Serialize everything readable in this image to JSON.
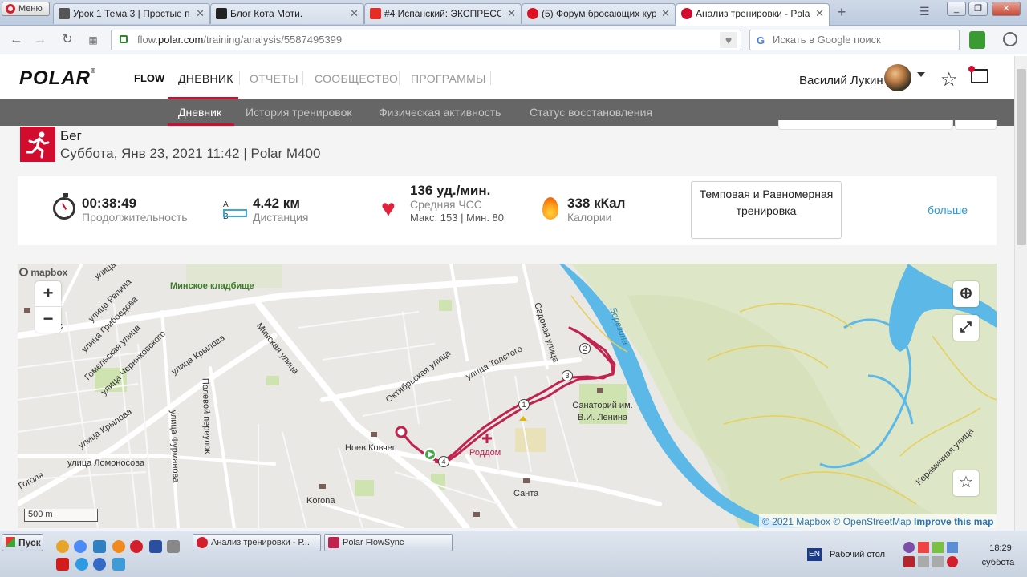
{
  "browser": {
    "menu_label": "Меню",
    "tabs": [
      {
        "title": "Урок 1 Тема 3 | Простые пр",
        "icon": "lesson-icon"
      },
      {
        "title": "Блог Кота Моти.",
        "icon": "cat-icon"
      },
      {
        "title": "#4 Испанский: ЭКСПРЕСС-",
        "icon": "youtube-icon"
      },
      {
        "title": "(5) Форум бросающих кури",
        "icon": "forum-icon"
      },
      {
        "title": "Анализ тренировки - Polar F",
        "icon": "polar-icon"
      }
    ],
    "url_prefix": "flow.",
    "url_domain": "polar.com",
    "url_path": "/training/analysis/5587495399",
    "search_placeholder": "Искать в Google поиск"
  },
  "polar": {
    "logo": "POLAR",
    "logo_mark": "®",
    "product": "FLOW",
    "nav": [
      "ДНЕВНИК",
      "ОТЧЕТЫ",
      "СООБЩЕСТВО",
      "ПРОГРАММЫ"
    ],
    "user_name": "Василий Лукин",
    "subnav": [
      "Дневник",
      "История тренировок",
      "Физическая активность",
      "Статус восстановления"
    ]
  },
  "session": {
    "sport": "Бег",
    "datetime_device": "Суббота, Янв 23, 2021 11:42 | Polar M400"
  },
  "stats": {
    "duration_value": "00:38:49",
    "duration_label": "Продолжительность",
    "distance_ab": "A B",
    "distance_value": "4.42 км",
    "distance_label": "Дистанция",
    "hr_value": "136 уд./мин.",
    "hr_label": "Средняя ЧСС",
    "hr_minmax": "Макс. 153 | Мин. 80",
    "calories_value": "338 кКал",
    "calories_label": "Калории",
    "training_type": "Темповая и Равномерная тренировка",
    "more_link": "больше"
  },
  "map": {
    "logo": "mapbox",
    "zoom_in": "+",
    "zoom_out": "−",
    "scale": "500 m",
    "attribution_mapbox": "© 2021 Mapbox",
    "attribution_osm": "© OpenStreetMap",
    "improve": "Improve this map",
    "labels": {
      "cemetery": "Минское кладбище",
      "river": "Березина",
      "sanatorium": "Санаторий им. В.И. Ленина",
      "maternity": "Роддом",
      "noev": "Ноев Ковчег",
      "korona": "Korona",
      "santa": "Санта",
      "minskaya": "Минская улица",
      "krylova1": "улица Крылова",
      "krylova2": "улица Крылова",
      "oktyabrskaya": "Октябрьская улица",
      "tolstogo": "улица Толстого",
      "sadovaya": "Садовая улица",
      "repina": "улица Репина",
      "griboedova": "улица Грибоедова",
      "gomelskaya": "Гомельская улица",
      "chernyakhovskogo": "улица Черняховского",
      "polevoy": "Полевой переулок",
      "furmanova": "улица Фурманова",
      "lomonosova": "улица Ломоносова",
      "gogolya": "Гоголя",
      "keramichnaya": "Керамичная улица",
      "frag1": "улица",
      "frag2": "кс"
    },
    "laps": [
      "1",
      "2",
      "3",
      "4"
    ],
    "colors": {
      "route": "#c0244e",
      "water": "#5cb8e6",
      "park": "#cfe3b0"
    }
  },
  "taskbar": {
    "start": "Пуск",
    "buttons": [
      "Анализ тренировки - Р...",
      "Polar FlowSync"
    ],
    "lang": "EN",
    "desktop": "Рабочий стол",
    "time": "18:29",
    "day": "суббота"
  }
}
